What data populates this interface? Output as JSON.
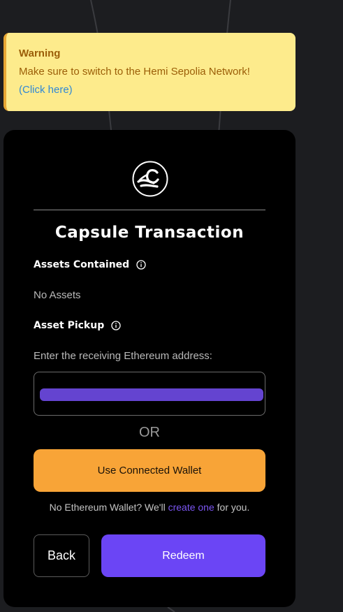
{
  "warning": {
    "title": "Warning",
    "message": "Make sure to switch to the Hemi Sepolia Network!",
    "link": "(Click here)"
  },
  "card": {
    "title": "Capsule Transaction",
    "assets_heading": "Assets Contained",
    "assets_value": "No Assets",
    "pickup_heading": "Asset Pickup",
    "address_label": "Enter the receiving Ethereum address:",
    "address_value": "",
    "or_text": "OR",
    "connect_wallet_label": "Use Connected Wallet",
    "no_wallet_prefix": "No Ethereum Wallet? We'll ",
    "no_wallet_link": "create one",
    "no_wallet_suffix": " for you.",
    "back_label": "Back",
    "redeem_label": "Redeem"
  },
  "icons": {
    "logo": "capsule-logo-icon",
    "info": "info-icon"
  },
  "colors": {
    "background": "#1c1d20",
    "warning_bg": "#fdeb8c",
    "warning_text": "#9b5e08",
    "warning_link": "#2f88d6",
    "card_bg": "#000000",
    "input_fill": "#6444d0",
    "connect_button": "#f8a437",
    "redeem_button": "#6b45f5",
    "link": "#7b56f2"
  }
}
